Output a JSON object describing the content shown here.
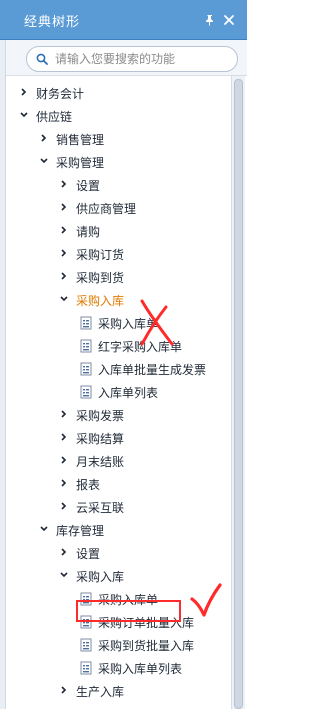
{
  "header": {
    "title": "经典树形"
  },
  "search": {
    "placeholder": "请输入您要搜索的功能"
  },
  "colors": {
    "accent": "#5b9bd5",
    "active": "#e07a00",
    "annotation": "#ff2b2b"
  },
  "tree": [
    {
      "id": "finance",
      "label": "财务会计",
      "level": 0,
      "expanded": false,
      "kind": "folder"
    },
    {
      "id": "supply-chain",
      "label": "供应链",
      "level": 0,
      "expanded": true,
      "kind": "folder"
    },
    {
      "id": "sales-mgmt",
      "label": "销售管理",
      "level": 1,
      "expanded": false,
      "kind": "folder"
    },
    {
      "id": "purchase-mgmt",
      "label": "采购管理",
      "level": 1,
      "expanded": true,
      "kind": "folder"
    },
    {
      "id": "settings",
      "label": "设置",
      "level": 2,
      "expanded": false,
      "kind": "folder"
    },
    {
      "id": "supplier-mgmt",
      "label": "供应商管理",
      "level": 2,
      "expanded": false,
      "kind": "folder"
    },
    {
      "id": "requisition",
      "label": "请购",
      "level": 2,
      "expanded": false,
      "kind": "folder"
    },
    {
      "id": "purchase-order",
      "label": "采购订货",
      "level": 2,
      "expanded": false,
      "kind": "folder"
    },
    {
      "id": "purchase-arrival",
      "label": "采购到货",
      "level": 2,
      "expanded": false,
      "kind": "folder"
    },
    {
      "id": "purchase-inbound",
      "label": "采购入库",
      "level": 2,
      "expanded": true,
      "kind": "folder",
      "active": true
    },
    {
      "id": "purchase-inbound-doc",
      "label": "采购入库单",
      "level": 3,
      "kind": "doc"
    },
    {
      "id": "red-purchase-inbound",
      "label": "红字采购入库单",
      "level": 3,
      "kind": "doc"
    },
    {
      "id": "inbound-batch-invoice",
      "label": "入库单批量生成发票",
      "level": 3,
      "kind": "doc"
    },
    {
      "id": "inbound-list",
      "label": "入库单列表",
      "level": 3,
      "kind": "doc"
    },
    {
      "id": "purchase-invoice",
      "label": "采购发票",
      "level": 2,
      "expanded": false,
      "kind": "folder"
    },
    {
      "id": "purchase-settlement",
      "label": "采购结算",
      "level": 2,
      "expanded": false,
      "kind": "folder"
    },
    {
      "id": "month-end",
      "label": "月末结账",
      "level": 2,
      "expanded": false,
      "kind": "folder"
    },
    {
      "id": "reports",
      "label": "报表",
      "level": 2,
      "expanded": false,
      "kind": "folder"
    },
    {
      "id": "cloud-purchase",
      "label": "云采互联",
      "level": 2,
      "expanded": false,
      "kind": "folder"
    },
    {
      "id": "inventory-mgmt",
      "label": "库存管理",
      "level": 1,
      "expanded": true,
      "kind": "folder"
    },
    {
      "id": "inv-settings",
      "label": "设置",
      "level": 2,
      "expanded": false,
      "kind": "folder"
    },
    {
      "id": "inv-purchase-inbound",
      "label": "采购入库",
      "level": 2,
      "expanded": true,
      "kind": "folder"
    },
    {
      "id": "inv-purchase-inbound-doc",
      "label": "采购入库单",
      "level": 3,
      "kind": "doc"
    },
    {
      "id": "po-batch-inbound",
      "label": "采购订单批量入库",
      "level": 3,
      "kind": "doc"
    },
    {
      "id": "arrival-batch-inbound",
      "label": "采购到货批量入库",
      "level": 3,
      "kind": "doc"
    },
    {
      "id": "inv-inbound-list",
      "label": "采购入库单列表",
      "level": 3,
      "kind": "doc"
    },
    {
      "id": "production-inbound",
      "label": "生产入库",
      "level": 2,
      "expanded": false,
      "kind": "folder"
    }
  ]
}
